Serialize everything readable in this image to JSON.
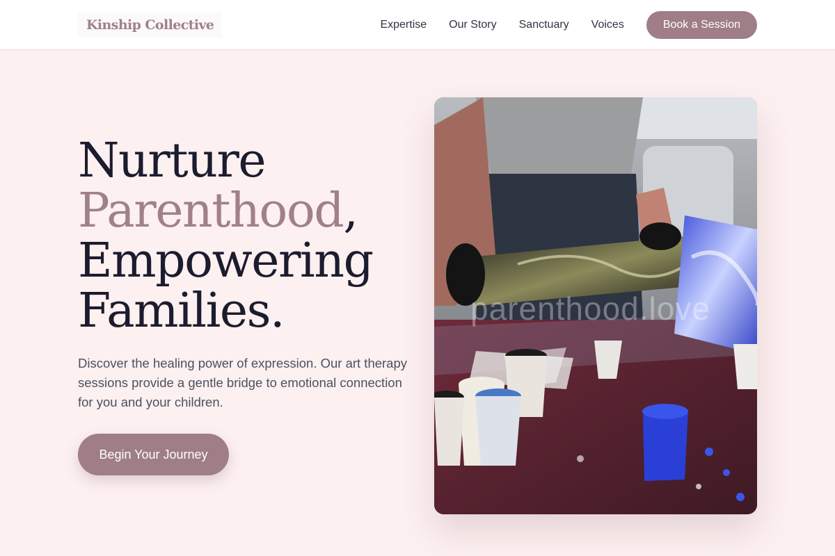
{
  "brand": {
    "name": "Kinship Collective"
  },
  "nav": {
    "links": [
      "Expertise",
      "Our Story",
      "Sanctuary",
      "Voices"
    ],
    "cta_label": "Book a Session"
  },
  "hero": {
    "title_line1": "Nurture",
    "title_accent": "Parenthood",
    "title_comma": ",",
    "title_line3": "Empowering",
    "title_line4": "Families.",
    "subtitle": "Discover the healing power of expression. Our art therapy sessions provide a gentle bridge to emotional connection for you and your children.",
    "cta_label": "Begin Your Journey",
    "image_watermark": "parenthood.love"
  },
  "colors": {
    "background": "#fdf0f0",
    "accent": "#9f7e87",
    "heading": "#1b1c2e",
    "body_text": "#4b5160"
  }
}
